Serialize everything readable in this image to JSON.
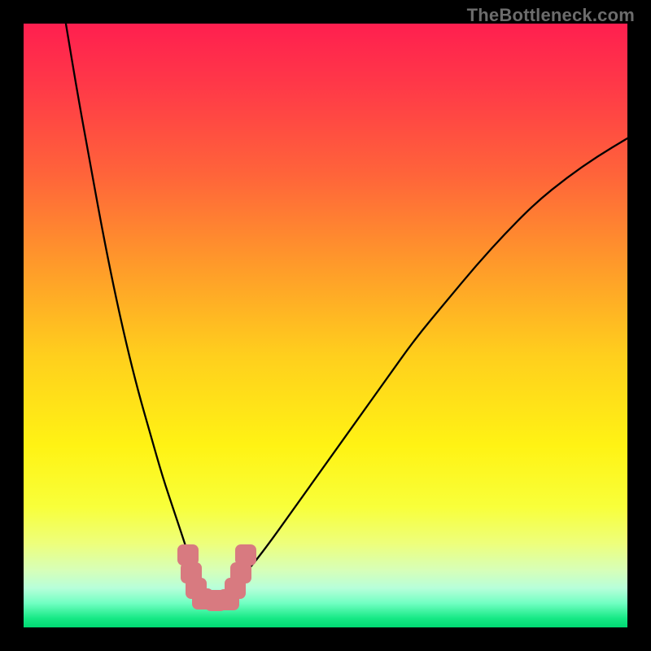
{
  "watermark": "TheBottleneck.com",
  "colors": {
    "page_bg": "#000000",
    "marker": "#d87a80",
    "curve": "#000000",
    "gradient_stops": [
      {
        "offset": 0.0,
        "color": "#ff1f4f"
      },
      {
        "offset": 0.1,
        "color": "#ff3848"
      },
      {
        "offset": 0.25,
        "color": "#ff643a"
      },
      {
        "offset": 0.4,
        "color": "#ff9a2a"
      },
      {
        "offset": 0.55,
        "color": "#ffcf1d"
      },
      {
        "offset": 0.7,
        "color": "#fff314"
      },
      {
        "offset": 0.8,
        "color": "#f8ff3a"
      },
      {
        "offset": 0.86,
        "color": "#eeff7a"
      },
      {
        "offset": 0.905,
        "color": "#d7ffb8"
      },
      {
        "offset": 0.935,
        "color": "#b7ffda"
      },
      {
        "offset": 0.96,
        "color": "#71ffc2"
      },
      {
        "offset": 0.985,
        "color": "#16e985"
      },
      {
        "offset": 1.0,
        "color": "#00d973"
      }
    ]
  },
  "chart_data": {
    "type": "line",
    "title": "",
    "xlabel": "",
    "ylabel": "",
    "xlim": [
      0,
      100
    ],
    "ylim": [
      0,
      100
    ],
    "series": [
      {
        "name": "bottleneck-curve",
        "x": [
          7,
          9,
          11,
          13,
          15,
          17,
          19,
          21,
          23,
          25,
          27,
          28.5,
          30,
          31.8,
          36,
          40,
          45,
          50,
          55,
          60,
          65,
          70,
          75,
          80,
          85,
          90,
          95,
          100
        ],
        "y": [
          100,
          88,
          77,
          66,
          56,
          47,
          39,
          32,
          25,
          19,
          13,
          8,
          4.5,
          4.5,
          8,
          13,
          20,
          27,
          34,
          41,
          48,
          54,
          60,
          65.5,
          70.5,
          74.5,
          78,
          81
        ]
      }
    ],
    "markers": {
      "name": "ideal-range-markers",
      "points": [
        {
          "x": 27.2,
          "y": 12.0
        },
        {
          "x": 27.8,
          "y": 9.0
        },
        {
          "x": 28.6,
          "y": 6.5
        },
        {
          "x": 29.6,
          "y": 4.7
        },
        {
          "x": 31.8,
          "y": 4.5
        },
        {
          "x": 34.0,
          "y": 4.6
        },
        {
          "x": 35.0,
          "y": 6.5
        },
        {
          "x": 36.0,
          "y": 9.0
        },
        {
          "x": 36.8,
          "y": 12.0
        }
      ]
    }
  }
}
